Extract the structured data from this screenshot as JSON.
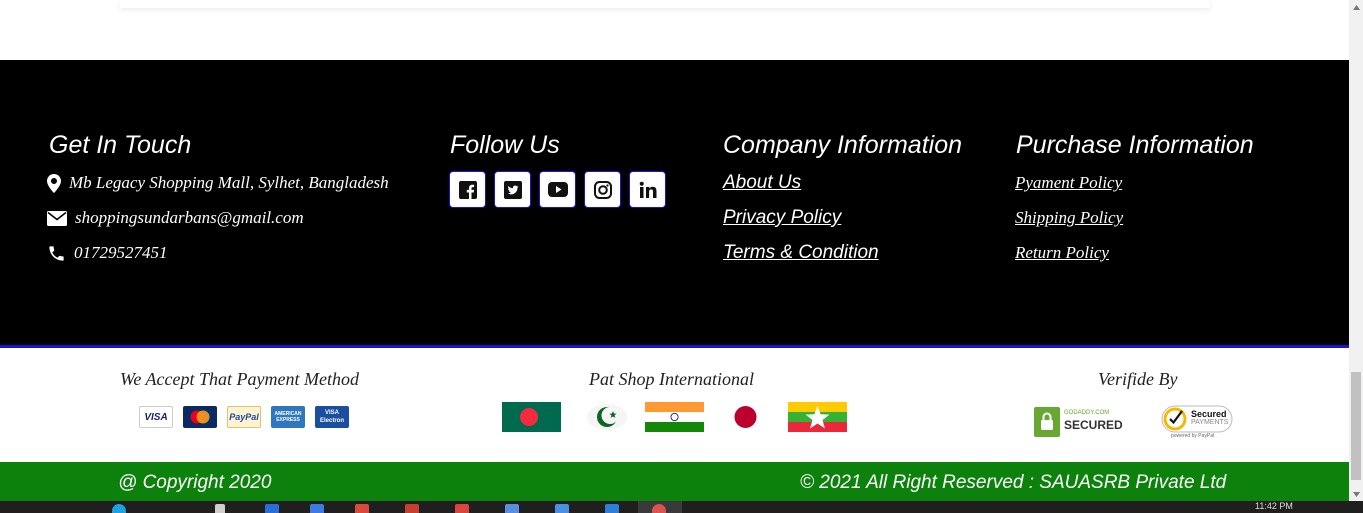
{
  "contact": {
    "heading": "Get In Touch",
    "address": "Mb Legacy Shopping Mall, Sylhet, Bangladesh",
    "email": "shoppingsundarbans@gmail.com",
    "phone": "01729527451"
  },
  "follow": {
    "heading": "Follow Us",
    "icons": [
      "facebook-icon",
      "twitter-icon",
      "youtube-icon",
      "instagram-icon",
      "linkedin-icon"
    ]
  },
  "company": {
    "heading": "Company Information",
    "links": [
      "About Us",
      "Privacy Policy",
      "Terms & Condition"
    ]
  },
  "purchase": {
    "heading": "Purchase Information",
    "links": [
      "Pyament Policy",
      "Shipping Policy",
      "Return Policy"
    ]
  },
  "payment": {
    "title": "We Accept That Payment Method",
    "cards": [
      "VISA",
      "MasterCard",
      "PayPal",
      "AMERICAN EXPRESS",
      "VISA Electron"
    ]
  },
  "international": {
    "title": "Pat Shop International",
    "flags": [
      "bangladesh-flag",
      "pakistan-flag",
      "india-flag",
      "japan-flag",
      "myanmar-flag"
    ]
  },
  "verified": {
    "title": "Verifide By",
    "godaddy_top": "GODADDY.COM",
    "godaddy_main": "SECURED",
    "paypal_line1": "Secured",
    "paypal_line2": "PAYMENTS",
    "paypal_line3": "powered by PayPal"
  },
  "copyright": {
    "left": "@ Copyright 2020",
    "right": "© 2021 All Right Reserved : SAUASRB Private Ltd"
  },
  "taskbar": {
    "time": "11:42 PM"
  },
  "colors": {
    "footer_bg": "#000000",
    "accent_line": "#1a12d6",
    "copyright_bg": "#0c820c"
  }
}
